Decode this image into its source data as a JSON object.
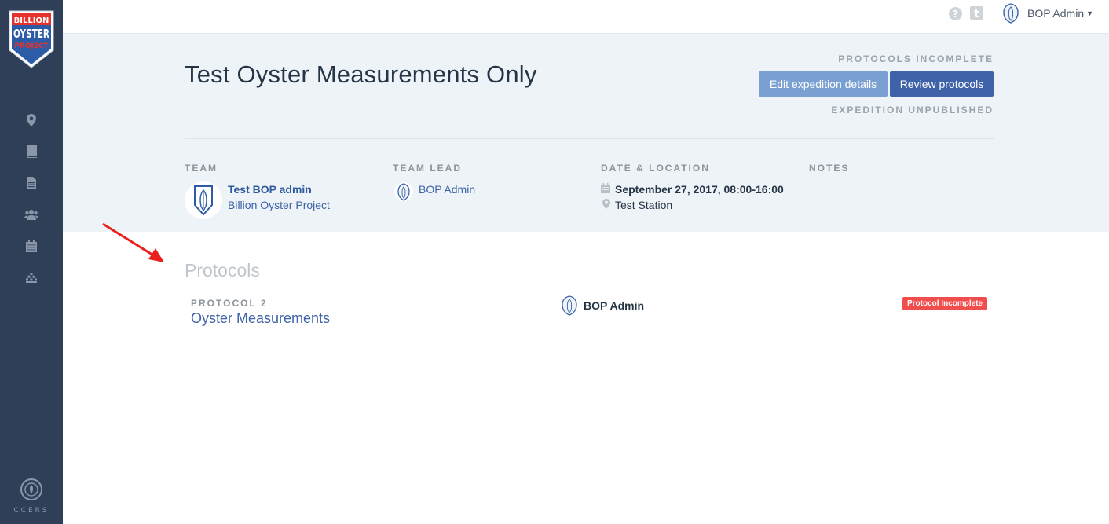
{
  "sidebar": {
    "logo": {
      "line1": "BILLION",
      "line2": "OYSTER",
      "line3": "PROJECT"
    },
    "items": [
      {
        "icon": "map-marker-icon"
      },
      {
        "icon": "book-icon"
      },
      {
        "icon": "document-icon"
      },
      {
        "icon": "users-icon"
      },
      {
        "icon": "calendar-icon"
      },
      {
        "icon": "chart-icon"
      }
    ],
    "footer_label": "CCERS"
  },
  "topbar": {
    "user_name": "BOP Admin",
    "help_icon": "question-circle-icon",
    "tumblr_icon": "tumblr-icon"
  },
  "expedition": {
    "title": "Test Oyster Measurements Only",
    "status_protocols": "PROTOCOLS INCOMPLETE",
    "status_publish": "EXPEDITION UNPUBLISHED",
    "edit_button": "Edit expedition details",
    "review_button": "Review protocols",
    "labels": {
      "team": "TEAM",
      "team_lead": "TEAM LEAD",
      "date_location": "DATE & LOCATION",
      "notes": "NOTES"
    },
    "team_name": "Test BOP admin",
    "team_org": "Billion Oyster Project",
    "team_lead_name": "BOP Admin",
    "date": "September 27, 2017, 08:00-16:00",
    "location": "Test Station"
  },
  "protocols": {
    "title": "Protocols",
    "items": [
      {
        "number": "PROTOCOL 2",
        "name": "Oyster Measurements",
        "owner": "BOP Admin",
        "status": "Protocol Incomplete"
      }
    ]
  },
  "colors": {
    "sidebar": "#2f3f58",
    "accent": "#3e63a8",
    "accent_light": "#7a9fd1",
    "header_bg": "#eef3f8",
    "badge_red": "#f04d4d",
    "arrow_red": "#e8201e"
  }
}
